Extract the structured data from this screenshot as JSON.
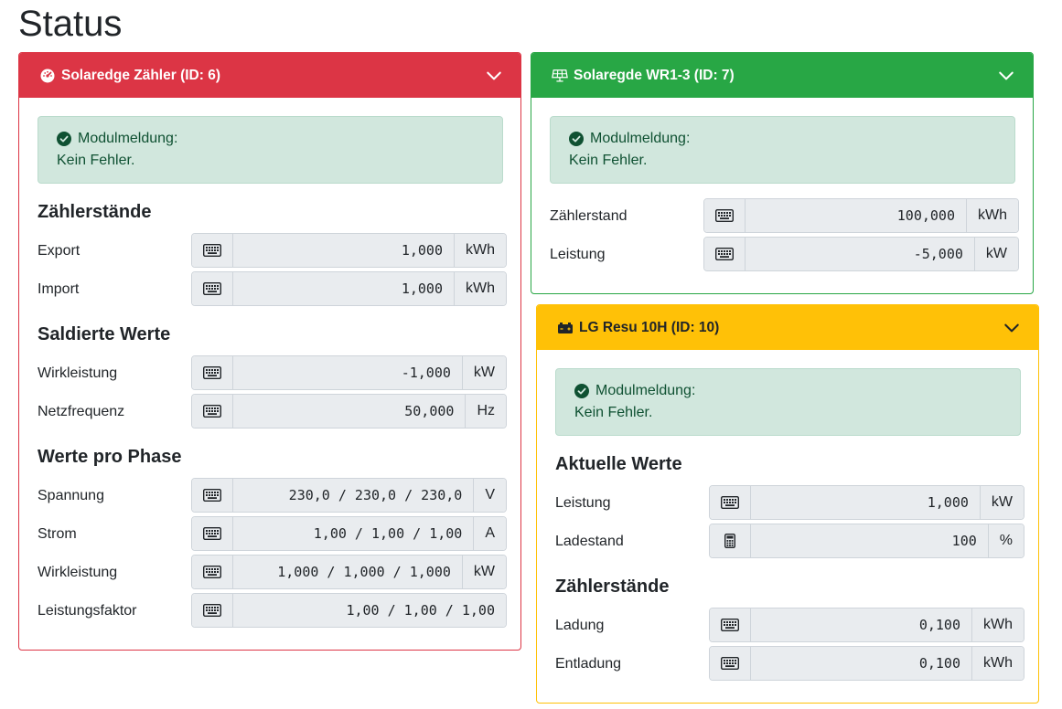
{
  "page": {
    "title": "Status"
  },
  "colors": {
    "danger": "#dc3545",
    "success": "#28a745",
    "warning": "#ffc107"
  },
  "cards": {
    "meter": {
      "title": "Solaredge Zähler (ID: 6)",
      "icon": "speedometer-icon",
      "alert": {
        "line1": "Modulmeldung:",
        "line2": "Kein Fehler."
      },
      "sections": [
        {
          "title": "Zählerstände",
          "rows": [
            {
              "label": "Export",
              "value": "1,000",
              "unit": "kWh"
            },
            {
              "label": "Import",
              "value": "1,000",
              "unit": "kWh"
            }
          ]
        },
        {
          "title": "Saldierte Werte",
          "rows": [
            {
              "label": "Wirkleistung",
              "value": "-1,000",
              "unit": "kW"
            },
            {
              "label": "Netzfrequenz",
              "value": "50,000",
              "unit": "Hz"
            }
          ]
        },
        {
          "title": "Werte pro Phase",
          "rows": [
            {
              "label": "Spannung",
              "value": "230,0 / 230,0 / 230,0",
              "unit": "V"
            },
            {
              "label": "Strom",
              "value": "1,00 / 1,00 / 1,00",
              "unit": "A"
            },
            {
              "label": "Wirkleistung",
              "value": "1,000 / 1,000 / 1,000",
              "unit": "kW"
            },
            {
              "label": "Leistungsfaktor",
              "value": "1,00 / 1,00 / 1,00",
              "unit": ""
            }
          ]
        }
      ]
    },
    "inverter": {
      "title": "Solaregde WR1-3 (ID: 7)",
      "icon": "solar-panel-icon",
      "alert": {
        "line1": "Modulmeldung:",
        "line2": "Kein Fehler."
      },
      "rows": [
        {
          "label": "Zählerstand",
          "value": "100,000",
          "unit": "kWh"
        },
        {
          "label": "Leistung",
          "value": "-5,000",
          "unit": "kW"
        }
      ]
    },
    "battery": {
      "title": "LG Resu 10H (ID: 10)",
      "icon": "battery-icon",
      "alert": {
        "line1": "Modulmeldung:",
        "line2": "Kein Fehler."
      },
      "sections": [
        {
          "title": "Aktuelle Werte",
          "rows": [
            {
              "label": "Leistung",
              "value": "1,000",
              "unit": "kW"
            },
            {
              "label": "Ladestand",
              "value": "100",
              "unit": "%"
            }
          ]
        },
        {
          "title": "Zählerstände",
          "rows": [
            {
              "label": "Ladung",
              "value": "0,100",
              "unit": "kWh"
            },
            {
              "label": "Entladung",
              "value": "0,100",
              "unit": "kWh"
            }
          ]
        }
      ]
    }
  }
}
